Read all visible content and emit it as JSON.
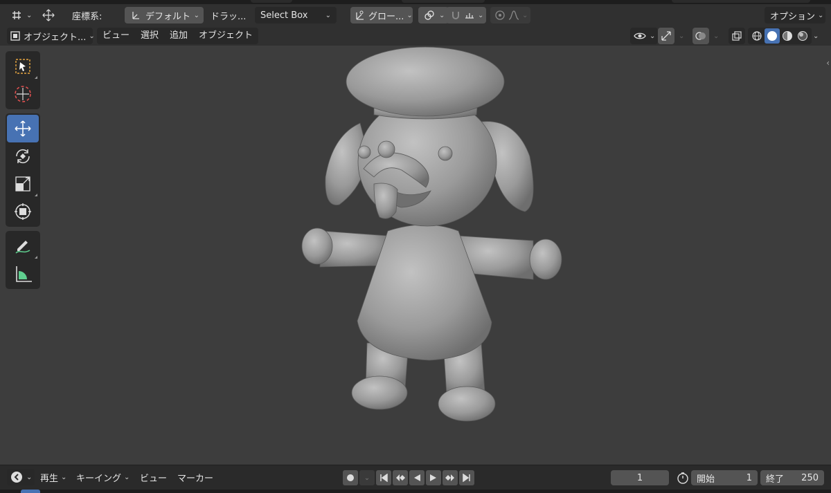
{
  "tool_header": {
    "transform_orientation_label": "座標系:",
    "orientation_value": "デフォルト",
    "drag_label": "ドラッ...",
    "select_mode": "Select Box",
    "pivot_value": "グロー...",
    "options_label": "オプション"
  },
  "view_header": {
    "mode_label": "オブジェクト...",
    "menus": [
      "ビュー",
      "選択",
      "追加",
      "オブジェクト"
    ]
  },
  "toolbar": {
    "tools": [
      "select-box",
      "cursor",
      "move",
      "rotate",
      "scale",
      "transform",
      "annotate",
      "measure"
    ],
    "active_tool": "move"
  },
  "viewport": {
    "shading_modes": [
      "wireframe",
      "solid",
      "material-preview",
      "rendered"
    ],
    "active_shading": "solid",
    "model_color": "#a4a4a4",
    "background_color": "#3d3d3d"
  },
  "timeline": {
    "menus": [
      "再生",
      "キーイング",
      "ビュー",
      "マーカー"
    ],
    "current_frame": "1",
    "start_label": "開始",
    "start_value": "1",
    "end_label": "終了",
    "end_value": "250"
  },
  "colors": {
    "accent": "#4772b3",
    "header": "#303030",
    "button": "#545454"
  }
}
